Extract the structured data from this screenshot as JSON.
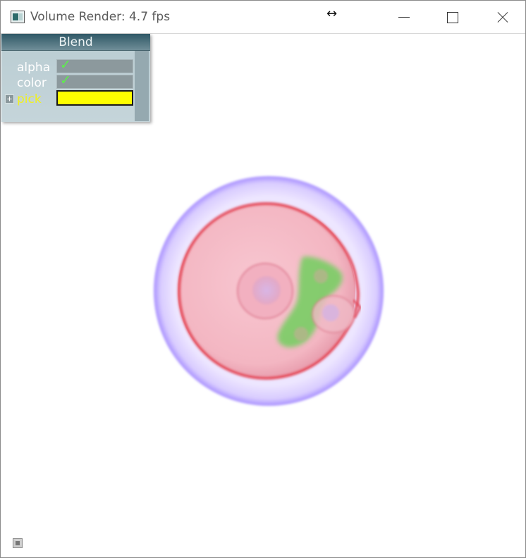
{
  "window": {
    "title": "Volume Render: 4.7 fps",
    "cursor_glyph": "↔",
    "controls": [
      "minimize",
      "maximize",
      "close"
    ]
  },
  "panel": {
    "title": "Blend",
    "rows": [
      {
        "label": "alpha",
        "checked": true,
        "check_glyph": "✓"
      },
      {
        "label": "color",
        "checked": true,
        "check_glyph": "✓"
      }
    ],
    "pick": {
      "label": "pick",
      "expand_glyph": "+",
      "color": "#ffff00"
    }
  },
  "render": {
    "outer_shell_color": "#b7a6ff",
    "cell_color": "#f0a3b2",
    "membrane_color": "#e84e62",
    "nucleus_color": "#c9a8d9",
    "green_region_color": "#6ad15a"
  },
  "icons": {
    "app": "app-icon",
    "bottom": "small-window-icon"
  }
}
